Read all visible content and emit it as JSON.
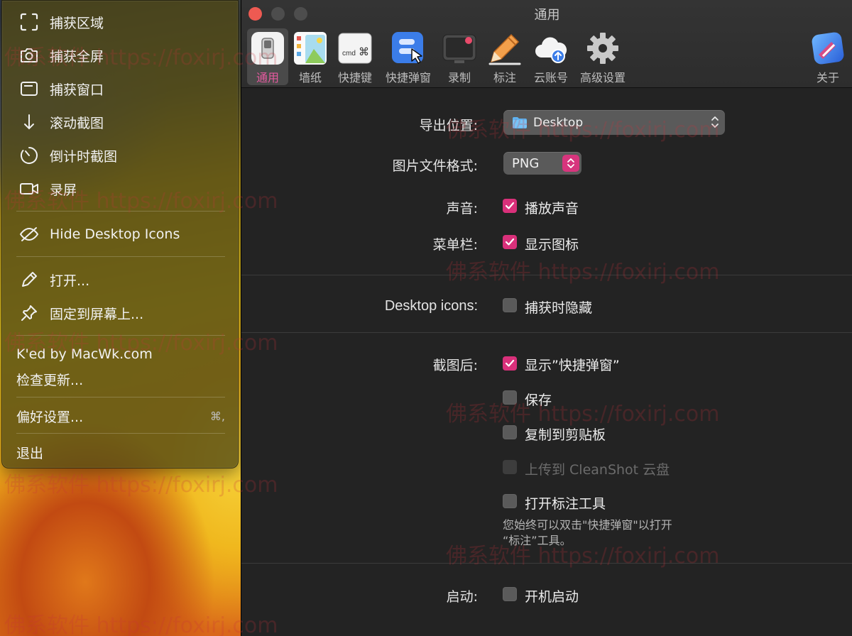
{
  "menu": {
    "items": [
      {
        "label": "捕获区域",
        "icon": "capture-area-icon"
      },
      {
        "label": "捕获全屏",
        "icon": "camera-icon"
      },
      {
        "label": "捕获窗口",
        "icon": "window-icon"
      },
      {
        "label": "滚动截图",
        "icon": "arrow-down-icon"
      },
      {
        "label": "倒计时截图",
        "icon": "timer-icon"
      },
      {
        "label": "录屏",
        "icon": "video-camera-icon"
      },
      {
        "label": "Hide Desktop Icons",
        "icon": "eye-slash-icon"
      },
      {
        "label": "打开...",
        "icon": "pencil-icon"
      },
      {
        "label": "固定到屏幕上...",
        "icon": "pin-icon"
      }
    ],
    "credit": "K'ed by MacWk.com",
    "check_updates": "检查更新...",
    "preferences": "偏好设置...",
    "preferences_shortcut": "⌘,",
    "quit": "退出"
  },
  "window": {
    "title": "通用",
    "tabs": [
      {
        "label": "通用",
        "icon": "general-switch-icon",
        "active": true
      },
      {
        "label": "墙纸",
        "icon": "wallpaper-icon"
      },
      {
        "label": "快捷键",
        "icon": "keyboard-shortcut-icon"
      },
      {
        "label": "快捷弹窗",
        "icon": "overlay-popup-icon"
      },
      {
        "label": "录制",
        "icon": "recording-icon"
      },
      {
        "label": "标注",
        "icon": "annotate-pencil-icon"
      },
      {
        "label": "云账号",
        "icon": "cloud-upload-icon"
      },
      {
        "label": "高级设置",
        "icon": "gear-icon"
      },
      {
        "label": "关于",
        "icon": "app-logo-icon"
      }
    ],
    "keyboard_icon_text": {
      "cmd": "cmd",
      "symbol": "⌘"
    }
  },
  "form": {
    "export_location": {
      "label": "导出位置:",
      "value": "Desktop"
    },
    "image_format": {
      "label": "图片文件格式:",
      "value": "PNG"
    },
    "sound": {
      "label": "声音:",
      "option": "播放声音",
      "checked": true
    },
    "menubar": {
      "label": "菜单栏:",
      "option": "显示图标",
      "checked": true
    },
    "desktop_icons": {
      "label": "Desktop icons:",
      "option": "捕获时隐藏",
      "checked": false
    },
    "after_capture": {
      "label": "截图后:",
      "options": [
        {
          "label": "显示”快捷弹窗”",
          "checked": true,
          "disabled": false
        },
        {
          "label": "保存",
          "checked": false,
          "disabled": false
        },
        {
          "label": "复制到剪贴板",
          "checked": false,
          "disabled": false
        },
        {
          "label": "上传到 CleanShot 云盘",
          "checked": false,
          "disabled": true
        },
        {
          "label": "打开标注工具",
          "checked": false,
          "disabled": false
        }
      ],
      "hint_line1": "您始终可以双击\"快捷弹窗\"以打开",
      "hint_line2": "“标注”工具。"
    },
    "startup": {
      "label": "启动:",
      "option": "开机启动",
      "checked": false
    }
  },
  "watermark": "佛系软件 https://foxirj.com",
  "colors": {
    "accent": "#d9307a",
    "close": "#ee5a52"
  }
}
